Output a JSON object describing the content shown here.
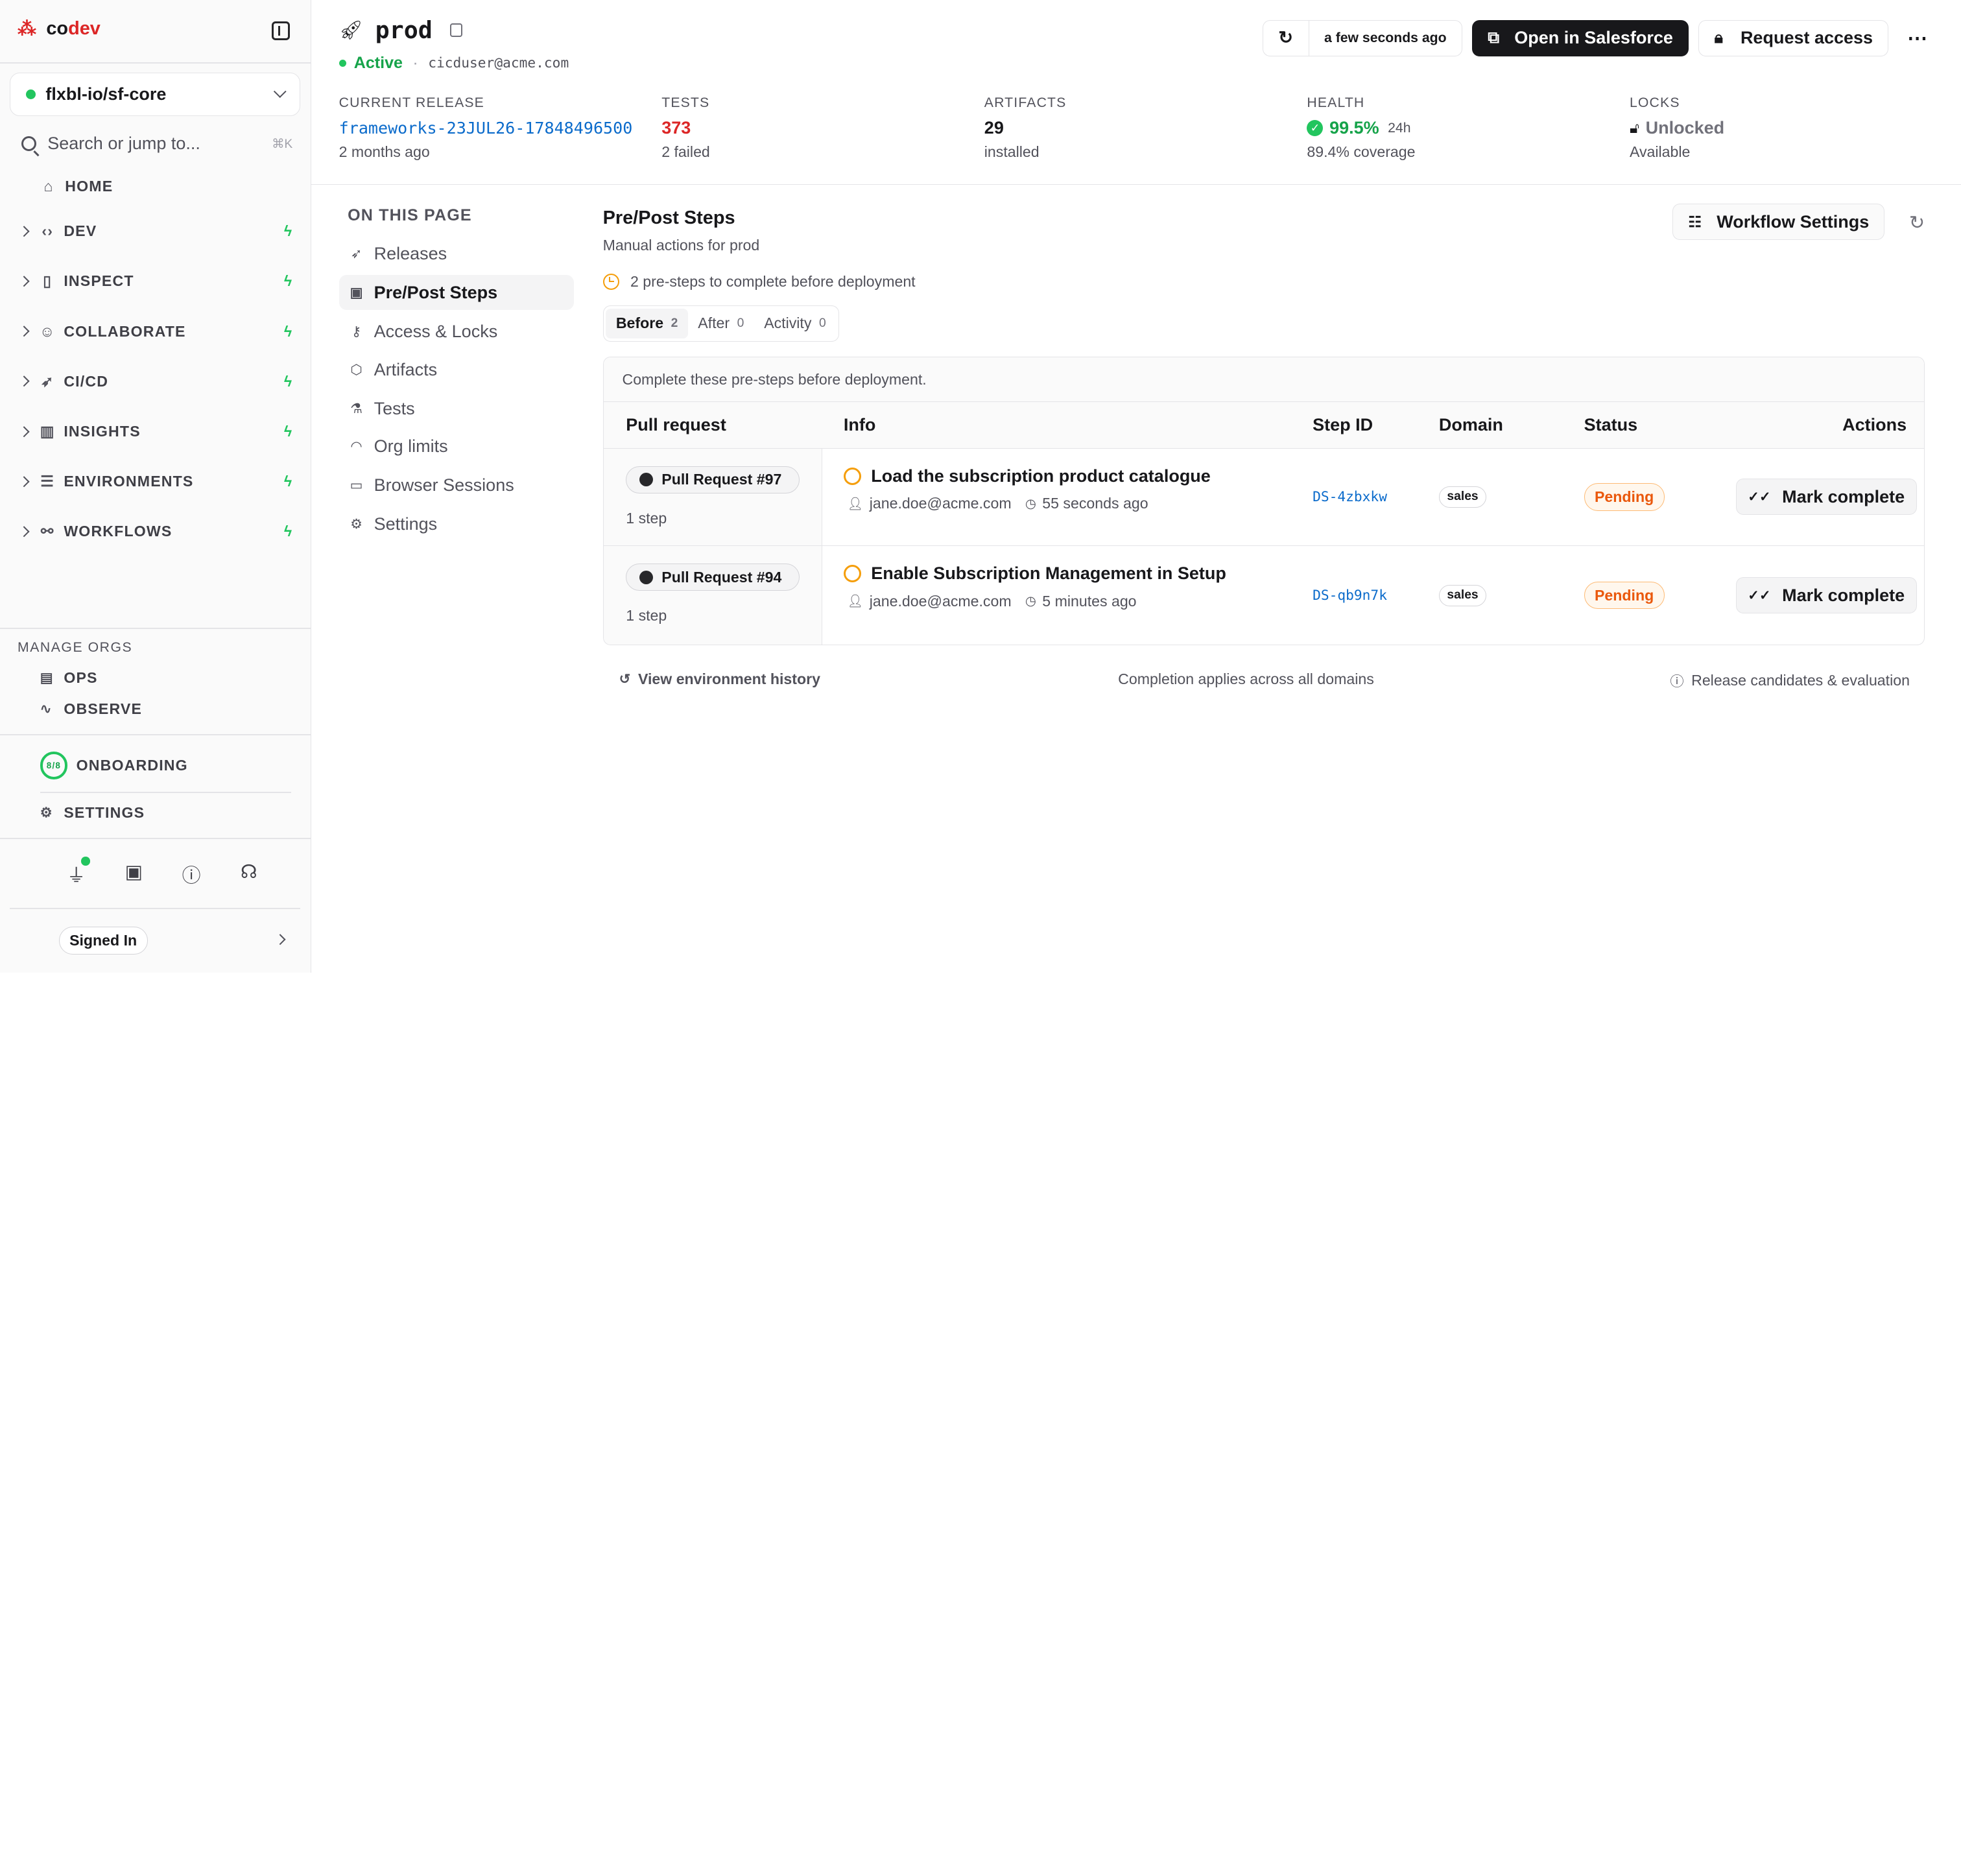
{
  "brand": {
    "name_a": "co",
    "name_b": "dev",
    "logo_icon": "codev-logo"
  },
  "sidebar": {
    "org": "flxbl-io/sf-core",
    "search_placeholder": "Search or jump to...",
    "search_shortcut": "⌘K",
    "home": "HOME",
    "sections": [
      {
        "label": "DEV",
        "icon": "code-icon"
      },
      {
        "label": "INSPECT",
        "icon": "inspect-icon"
      },
      {
        "label": "COLLABORATE",
        "icon": "users-icon"
      },
      {
        "label": "CI/CD",
        "icon": "rocket-icon"
      },
      {
        "label": "INSIGHTS",
        "icon": "chart-icon"
      },
      {
        "label": "ENVIRONMENTS",
        "icon": "server-icon"
      },
      {
        "label": "WORKFLOWS",
        "icon": "workflow-icon"
      }
    ],
    "manage_label": "MANAGE ORGS",
    "manage_items": [
      {
        "label": "OPS",
        "icon": "clipboard-icon"
      },
      {
        "label": "OBSERVE",
        "icon": "activity-icon"
      }
    ],
    "onboarding": {
      "label": "ONBOARDING",
      "progress_text": "8/8",
      "progress": 1.0
    },
    "settings": "SETTINGS",
    "signed_in": "Signed In"
  },
  "header": {
    "title": "prod",
    "status": "Active",
    "user": "cicduser@acme.com",
    "refreshed": "a few seconds ago",
    "open_salesforce": "Open in Salesforce",
    "request_access": "Request access"
  },
  "stats": {
    "release": {
      "label": "CURRENT RELEASE",
      "value": "frameworks-23JUL26-17848496500",
      "sub": "2 months ago"
    },
    "tests": {
      "label": "TESTS",
      "value": "373",
      "sub": "2 failed"
    },
    "artifacts": {
      "label": "ARTIFACTS",
      "value": "29",
      "sub": "installed"
    },
    "health": {
      "label": "HEALTH",
      "value": "99.5%",
      "window": "24h",
      "sub": "89.4% coverage"
    },
    "locks": {
      "label": "LOCKS",
      "value": "Unlocked",
      "sub": "Available"
    }
  },
  "toc": {
    "title": "ON THIS PAGE",
    "items": [
      {
        "label": "Releases",
        "icon": "rocket-icon"
      },
      {
        "label": "Pre/Post Steps",
        "icon": "clipboard-check-icon"
      },
      {
        "label": "Access & Locks",
        "icon": "key-icon"
      },
      {
        "label": "Artifacts",
        "icon": "package-icon"
      },
      {
        "label": "Tests",
        "icon": "flask-icon"
      },
      {
        "label": "Org limits",
        "icon": "gauge-icon"
      },
      {
        "label": "Browser Sessions",
        "icon": "browser-icon"
      },
      {
        "label": "Settings",
        "icon": "gear-icon"
      }
    ]
  },
  "steps": {
    "title": "Pre/Post Steps",
    "subtitle": "Manual actions for prod",
    "warning": "2 pre-steps to complete before deployment",
    "workflow_settings": "Workflow Settings",
    "tabs": [
      {
        "label": "Before",
        "count": "2"
      },
      {
        "label": "After",
        "count": "0"
      },
      {
        "label": "Activity",
        "count": "0"
      }
    ],
    "note": "Complete these pre-steps before deployment.",
    "columns": [
      "Pull request",
      "Info",
      "Step ID",
      "Domain",
      "Status",
      "Actions"
    ],
    "rows": [
      {
        "pr": "Pull Request #97",
        "steps": "1 step",
        "title": "Load the subscription product catalogue",
        "user": "jane.doe@acme.com",
        "time": "55 seconds ago",
        "step_id": "DS-4zbxkw",
        "domain": "sales",
        "status": "Pending",
        "action": "Mark complete"
      },
      {
        "pr": "Pull Request #94",
        "steps": "1 step",
        "title": "Enable Subscription Management in Setup",
        "user": "jane.doe@acme.com",
        "time": "5 minutes ago",
        "step_id": "DS-qb9n7k",
        "domain": "sales",
        "status": "Pending",
        "action": "Mark complete"
      }
    ],
    "footer_left": "View environment history",
    "footer_center": "Completion applies across all domains",
    "footer_right": "Release candidates & evaluation"
  },
  "colors": {
    "accent": "#dc2626",
    "success": "#22c55e",
    "warning": "#f59e0b",
    "link": "#0b6bcb"
  }
}
